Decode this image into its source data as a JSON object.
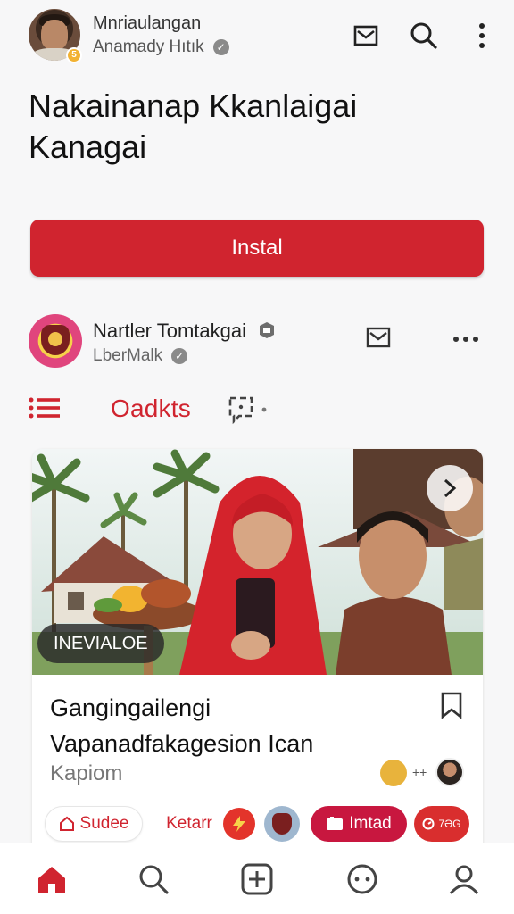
{
  "header": {
    "name": "Mnriaulangan",
    "subtitle": "Anamady Hıtık",
    "avatar_badge": "5"
  },
  "headline": {
    "line1": "Nakainanap Kkanlaigai",
    "line2": "Kanagai"
  },
  "install_label": "Instal",
  "channel": {
    "name": "Nartler Tomtakgai",
    "subtitle": "LberMalk"
  },
  "tabs": {
    "active_label": "Oadkts"
  },
  "card": {
    "badge": "INEVIALOE",
    "title_line1": "Gangingailengi",
    "title_line2": "Vapanadfakagesion Ican",
    "meta": "Kapiom",
    "reaction_plus": "++",
    "actions": {
      "save": "Sudee",
      "share": "Ketarr",
      "limited": "Imtad",
      "count": "7ƏG"
    }
  },
  "colors": {
    "accent": "#d0242f",
    "text": "#111111",
    "muted": "#777777",
    "background": "#f7f7f8"
  },
  "icons": {
    "header": [
      "mail-icon",
      "search-icon",
      "more-vertical-icon"
    ],
    "channel": [
      "mail-icon",
      "more-horizontal-icon"
    ],
    "tabs": [
      "list-icon",
      "chat-icon"
    ],
    "nav": [
      "home-icon",
      "search-icon",
      "add-icon",
      "chat-icon",
      "profile-icon"
    ]
  }
}
